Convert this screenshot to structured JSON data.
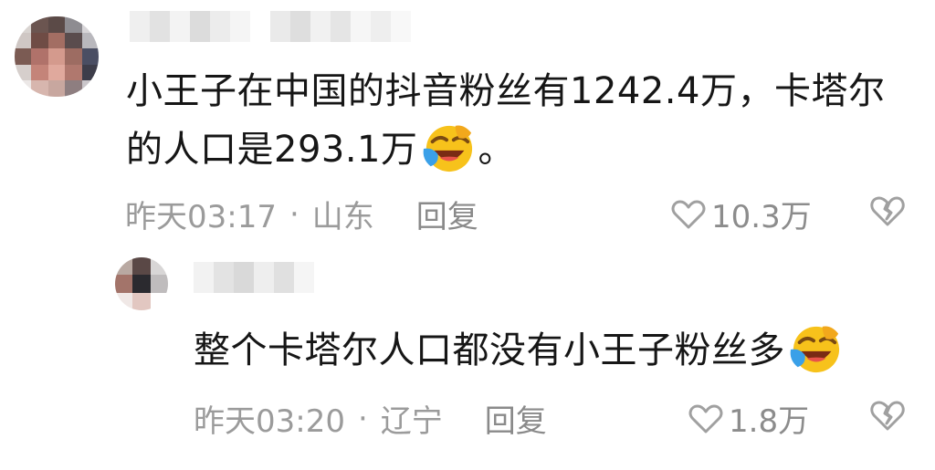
{
  "colors": {
    "text": "#161616",
    "meta": "#9b9b9b",
    "icon": "#8c8c8c",
    "background": "#ffffff"
  },
  "comments": [
    {
      "avatar_icon": "blurred-avatar",
      "text_main": "小王子在中国的抖音粉丝有1242.4万，卡塔尔的人口是293.1万",
      "text_end": "。",
      "emoji": "laughing-tears-emoji",
      "time": "昨天03:17",
      "separator": "·",
      "location": "山东",
      "reply_label": "回复",
      "likes": "10.3万"
    },
    {
      "avatar_icon": "blurred-avatar",
      "text_main": "整个卡塔尔人口都没有小王子粉丝多",
      "text_end": "",
      "emoji": "laughing-tears-emoji",
      "time": "昨天03:20",
      "separator": "·",
      "location": "辽宁",
      "reply_label": "回复",
      "likes": "1.8万"
    }
  ]
}
